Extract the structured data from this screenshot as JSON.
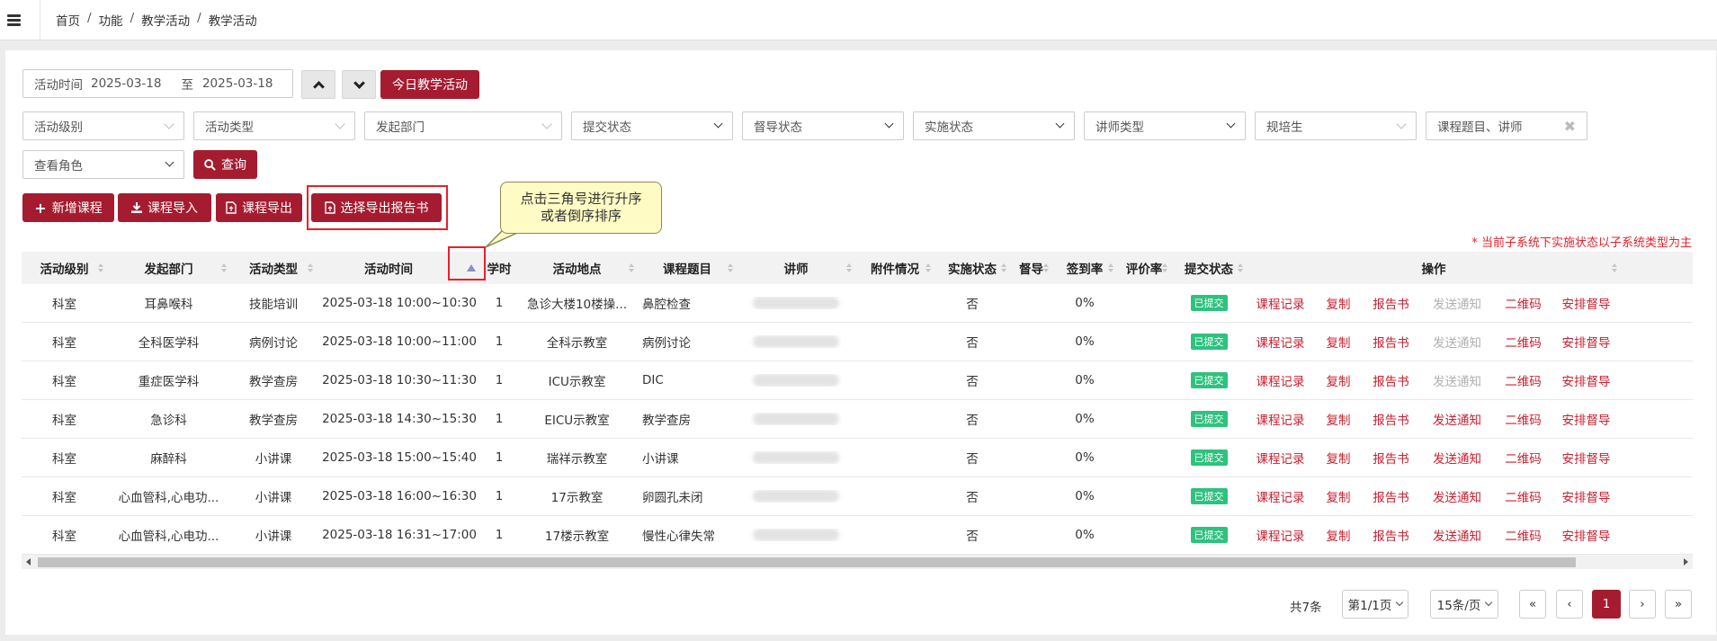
{
  "breadcrumb": [
    "首页",
    "功能",
    "教学活动",
    "教学活动"
  ],
  "filters": {
    "activity_time_label": "活动时间",
    "date_start": "2025-03-18",
    "date_to": "至",
    "date_end": "2025-03-18",
    "today_button": "今日教学活动",
    "level": "活动级别",
    "type": "活动类型",
    "department": "发起部门",
    "submit_status": "提交状态",
    "supervise_status": "督导状态",
    "impl_status": "实施状态",
    "lecturer_type": "讲师类型",
    "trainee": "规培生",
    "keyword_placeholder": "课程题目、讲师",
    "role": "查看角色",
    "search_button": "查询"
  },
  "toolbar": {
    "add": "新增课程",
    "import": "课程导入",
    "export": "课程导出",
    "export_report": "选择导出报告书"
  },
  "tooltip": {
    "line1": "点击三角号进行升序",
    "line2": "或者倒序排序"
  },
  "note": "* 当前子系统下实施状态以子系统类型为主",
  "columns": [
    "活动级别",
    "发起部门",
    "活动类型",
    "活动时间",
    "学时",
    "活动地点",
    "课程题目",
    "讲师",
    "附件情况",
    "实施状态",
    "督导",
    "签到率",
    "评价率",
    "提交状态",
    "操作"
  ],
  "rows": [
    {
      "level": "科室",
      "dept": "耳鼻喉科",
      "type": "技能培训",
      "time": "2025-03-18  10:00~10:30",
      "hours": "1",
      "place": "急诊大楼10楼操...",
      "topic": "鼻腔检查",
      "impl": "否",
      "sign": "0%",
      "status": "已提交",
      "notify_disabled": true
    },
    {
      "level": "科室",
      "dept": "全科医学科",
      "type": "病例讨论",
      "time": "2025-03-18  10:00~11:00",
      "hours": "1",
      "place": "全科示教室",
      "topic": "病例讨论",
      "impl": "否",
      "sign": "0%",
      "status": "已提交",
      "notify_disabled": true
    },
    {
      "level": "科室",
      "dept": "重症医学科",
      "type": "教学查房",
      "time": "2025-03-18  10:30~11:30",
      "hours": "1",
      "place": "ICU示教室",
      "topic": "DIC",
      "impl": "否",
      "sign": "0%",
      "status": "已提交",
      "notify_disabled": true
    },
    {
      "level": "科室",
      "dept": "急诊科",
      "type": "教学查房",
      "time": "2025-03-18  14:30~15:30",
      "hours": "1",
      "place": "EICU示教室",
      "topic": "教学查房",
      "impl": "否",
      "sign": "0%",
      "status": "已提交",
      "notify_disabled": false
    },
    {
      "level": "科室",
      "dept": "麻醉科",
      "type": "小讲课",
      "time": "2025-03-18  15:00~15:40",
      "hours": "1",
      "place": "瑞祥示教室",
      "topic": "小讲课",
      "impl": "否",
      "sign": "0%",
      "status": "已提交",
      "notify_disabled": false
    },
    {
      "level": "科室",
      "dept": "心血管科,心电功...",
      "type": "小讲课",
      "time": "2025-03-18  16:00~16:30",
      "hours": "1",
      "place": "17示教室",
      "topic": "卵圆孔未闭",
      "impl": "否",
      "sign": "0%",
      "status": "已提交",
      "notify_disabled": false
    },
    {
      "level": "科室",
      "dept": "心血管科,心电功...",
      "type": "小讲课",
      "time": "2025-03-18  16:31~17:00",
      "hours": "1",
      "place": "17楼示教室",
      "topic": "慢性心律失常",
      "impl": "否",
      "sign": "0%",
      "status": "已提交",
      "notify_disabled": false
    }
  ],
  "operations": [
    "课程记录",
    "复制",
    "报告书",
    "发送通知",
    "二维码",
    "安排督导"
  ],
  "pagination": {
    "total": "共7条",
    "page_select": "第1/1页",
    "size_select": "15条/页",
    "first": "«",
    "prev": "‹",
    "current": "1",
    "next": "›",
    "last": "»"
  }
}
